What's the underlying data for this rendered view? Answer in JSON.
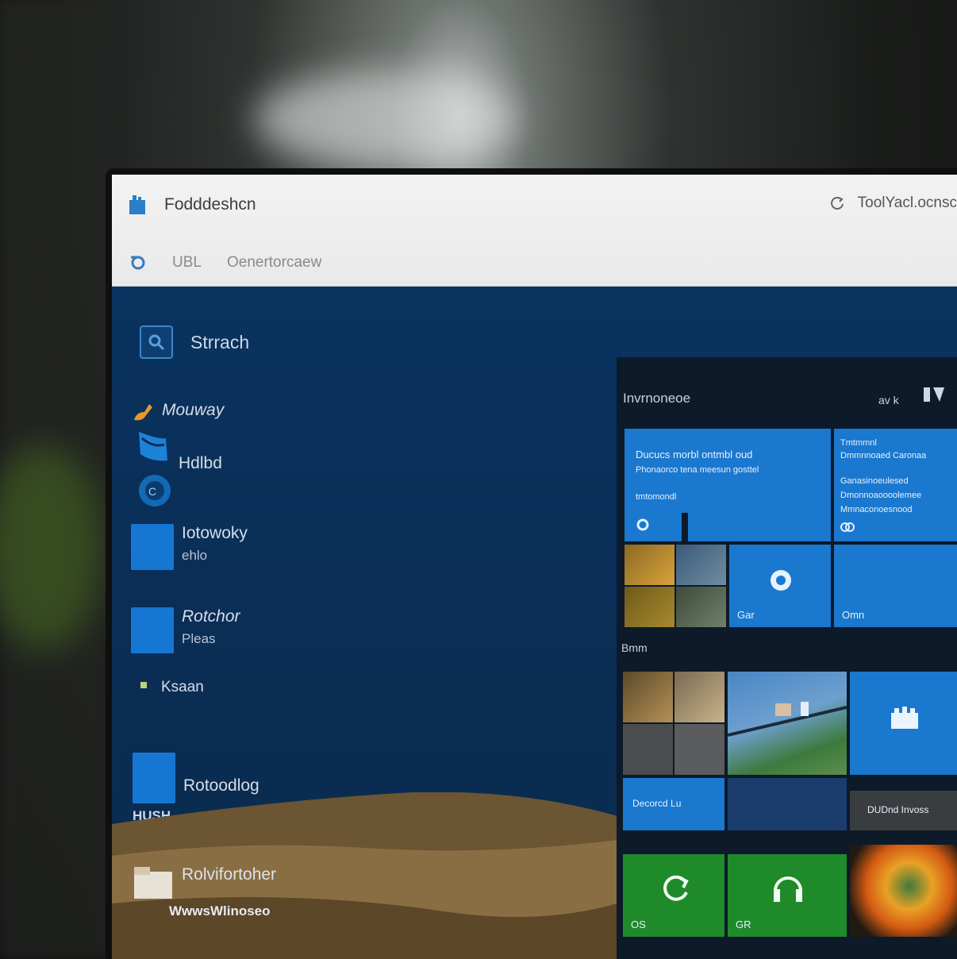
{
  "window": {
    "title": "Fodddeshcn",
    "right_text": "ToolYacl.ocnsc",
    "address_left": "UBL",
    "address_right": "Oenertorcaew"
  },
  "start_menu": {
    "search_label": "Strrach",
    "items": [
      {
        "label": "Mouway",
        "sub": ""
      },
      {
        "label": "Hdlbd",
        "sub": ""
      },
      {
        "label": "Iotowoky",
        "sub": "ehlo"
      },
      {
        "label": "Rotchor",
        "sub": "Pleas"
      },
      {
        "label": "Ksaan",
        "sub": ""
      },
      {
        "label": "Rotoodlog",
        "sub": "HUSH"
      },
      {
        "label": "Rolvifortoher",
        "sub": "WwwsWlinoseo"
      }
    ]
  },
  "tiles": {
    "group1_title": "Invrnoneoe",
    "group1_right": "av k",
    "group2_title": "Bmm",
    "tile_a_lines": [
      "Ducucs morbl ontmbl oud",
      "Phonaorco tena meesun gosttel",
      "tmtomondl"
    ],
    "tile_b_lines": [
      "Tmtmmnl",
      "Dmmnnoaed Caronaa",
      "Ganasinoeulesed",
      "Dmonnoaoooolemee",
      "Mmnaconoesnood"
    ],
    "tile_c_label": "Gar",
    "tile_d_label": "Omn",
    "tile_e_text": "Decorcd Lu",
    "tile_f_text": "DUDnd Invoss",
    "tile_g_label": "OS",
    "tile_h_label": "GR"
  }
}
